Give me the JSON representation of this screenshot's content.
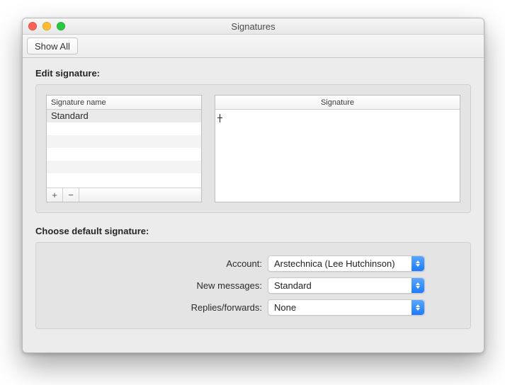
{
  "window": {
    "title": "Signatures"
  },
  "toolbar": {
    "show_all_label": "Show All"
  },
  "edit": {
    "section_label": "Edit signature:",
    "list_header": "Signature name",
    "signatures": [
      "Standard"
    ],
    "add_label": "+",
    "remove_label": "−",
    "editor_header": "Signature",
    "editor_content": ""
  },
  "defaults": {
    "section_label": "Choose default signature:",
    "account_label": "Account:",
    "account_value": "Arstechnica (Lee Hutchinson)",
    "new_messages_label": "New messages:",
    "new_messages_value": "Standard",
    "replies_label": "Replies/forwards:",
    "replies_value": "None"
  }
}
